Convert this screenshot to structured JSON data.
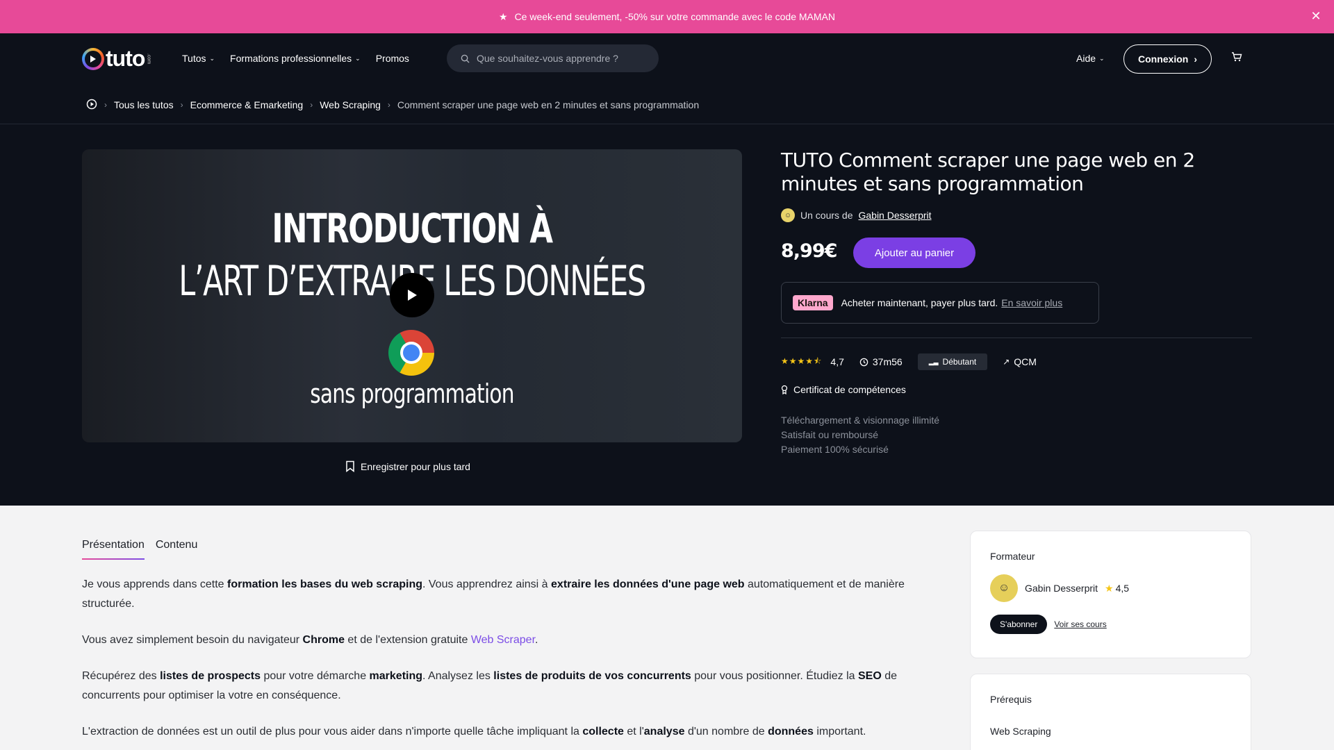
{
  "promo": {
    "text": "Ce week-end seulement, -50% sur votre commande avec le code MAMAN",
    "close_icon": "✕"
  },
  "header": {
    "logo_text": "tuto",
    "logo_sub": ".com",
    "nav": [
      {
        "label": "Tutos",
        "has_dropdown": true
      },
      {
        "label": "Formations professionnelles",
        "has_dropdown": true
      },
      {
        "label": "Promos",
        "has_dropdown": false
      }
    ],
    "search_placeholder": "Que souhaitez-vous apprendre ?",
    "aide": "Aide",
    "connexion": "Connexion"
  },
  "breadcrumb": [
    "Tous les tutos",
    "Ecommerce & Emarketing",
    "Web Scraping",
    "Comment scraper une page web en 2 minutes et sans programmation"
  ],
  "video": {
    "title_line1": "INTRODUCTION À",
    "title_line2": "L’ART D’EXTRAIRE LES DONNÉES",
    "subtitle": "sans programmation"
  },
  "save_later": "Enregistrer pour plus tard",
  "course": {
    "title": "TUTO Comment scraper une page web en 2 minutes et sans programmation",
    "author_prefix": "Un cours de",
    "author_name": "Gabin Desserprit",
    "price": "8,99€",
    "add_to_cart": "Ajouter au panier",
    "klarna_logo": "Klarna",
    "klarna_text": "Acheter maintenant, payer plus tard.",
    "klarna_link": "En savoir plus",
    "rating": "4,7",
    "rating_value": 4.7,
    "duration": "37m56",
    "level": "Débutant",
    "qcm": "QCM",
    "certificate": "Certificat de compétences",
    "perks": [
      "Téléchargement & visionnage illimité",
      "Satisfait ou remboursé",
      "Paiement 100% sécurisé"
    ]
  },
  "tabs": [
    "Présentation",
    "Contenu"
  ],
  "description": {
    "p1": [
      "Je vous apprends dans cette ",
      "formation les bases du web scraping",
      ". Vous apprendrez ainsi à ",
      "extraire les données d'une page web",
      " automatiquement et de manière structurée."
    ],
    "p2": [
      "Vous avez simplement besoin du navigateur ",
      "Chrome",
      " et de l'extension gratuite ",
      "Web Scraper",
      "."
    ],
    "p3": [
      "Récupérez des ",
      "listes de prospects",
      " pour votre démarche ",
      "marketing",
      ". Analysez les ",
      "listes de produits de vos concurrents",
      " pour vous positionner. Étudiez la ",
      "SEO",
      " de concurrents pour optimiser la votre en conséquence."
    ],
    "p4": [
      "L'extraction de données est un outil de plus pour vous aider dans n'importe quelle tâche impliquant la ",
      "collecte",
      " et l'",
      "analyse",
      " d'un nombre de ",
      "données",
      " important."
    ]
  },
  "trainer_card": {
    "title": "Formateur",
    "name": "Gabin Desserprit",
    "rating": "4,5",
    "subscribe": "S'abonner",
    "see_courses": "Voir ses cours"
  },
  "prereq_card": {
    "title": "Prérequis",
    "item": "Web Scraping"
  },
  "colors": {
    "promo": "#e74a98",
    "accent": "#7b3fe4",
    "dark_bg": "#0d111a",
    "klarna": "#ffa8cd"
  }
}
